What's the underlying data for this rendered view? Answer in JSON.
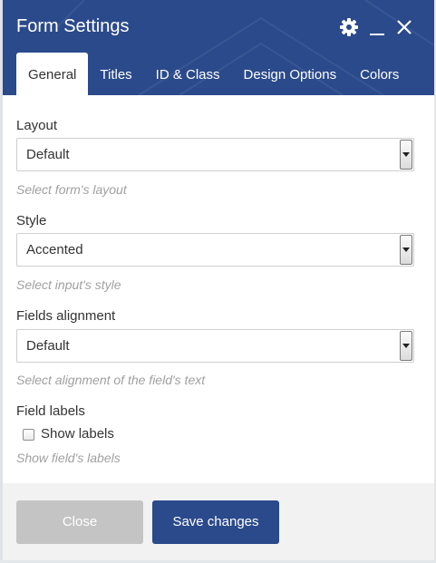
{
  "dialog": {
    "title": "Form Settings",
    "header_icons": [
      "gear-icon",
      "minimize-icon",
      "close-icon"
    ]
  },
  "tabs": [
    {
      "label": "General",
      "active": true
    },
    {
      "label": "Titles",
      "active": false
    },
    {
      "label": "ID & Class",
      "active": false
    },
    {
      "label": "Design Options",
      "active": false
    },
    {
      "label": "Colors",
      "active": false
    }
  ],
  "fields": {
    "layout": {
      "label": "Layout",
      "value": "Default",
      "help": "Select form's layout"
    },
    "style": {
      "label": "Style",
      "value": "Accented",
      "help": "Select input's style"
    },
    "alignment": {
      "label": "Fields alignment",
      "value": "Default",
      "help": "Select alignment of the field's text"
    },
    "labels": {
      "label": "Field labels",
      "checkbox_label": "Show labels",
      "checked": false,
      "help": "Show field's labels"
    }
  },
  "footer": {
    "close_label": "Close",
    "save_label": "Save changes"
  },
  "colors": {
    "header": "#2b4a8b",
    "primary_button": "#2b4a8b",
    "disabled_button": "#c4c4c4",
    "help_text": "#a0a0a0"
  }
}
